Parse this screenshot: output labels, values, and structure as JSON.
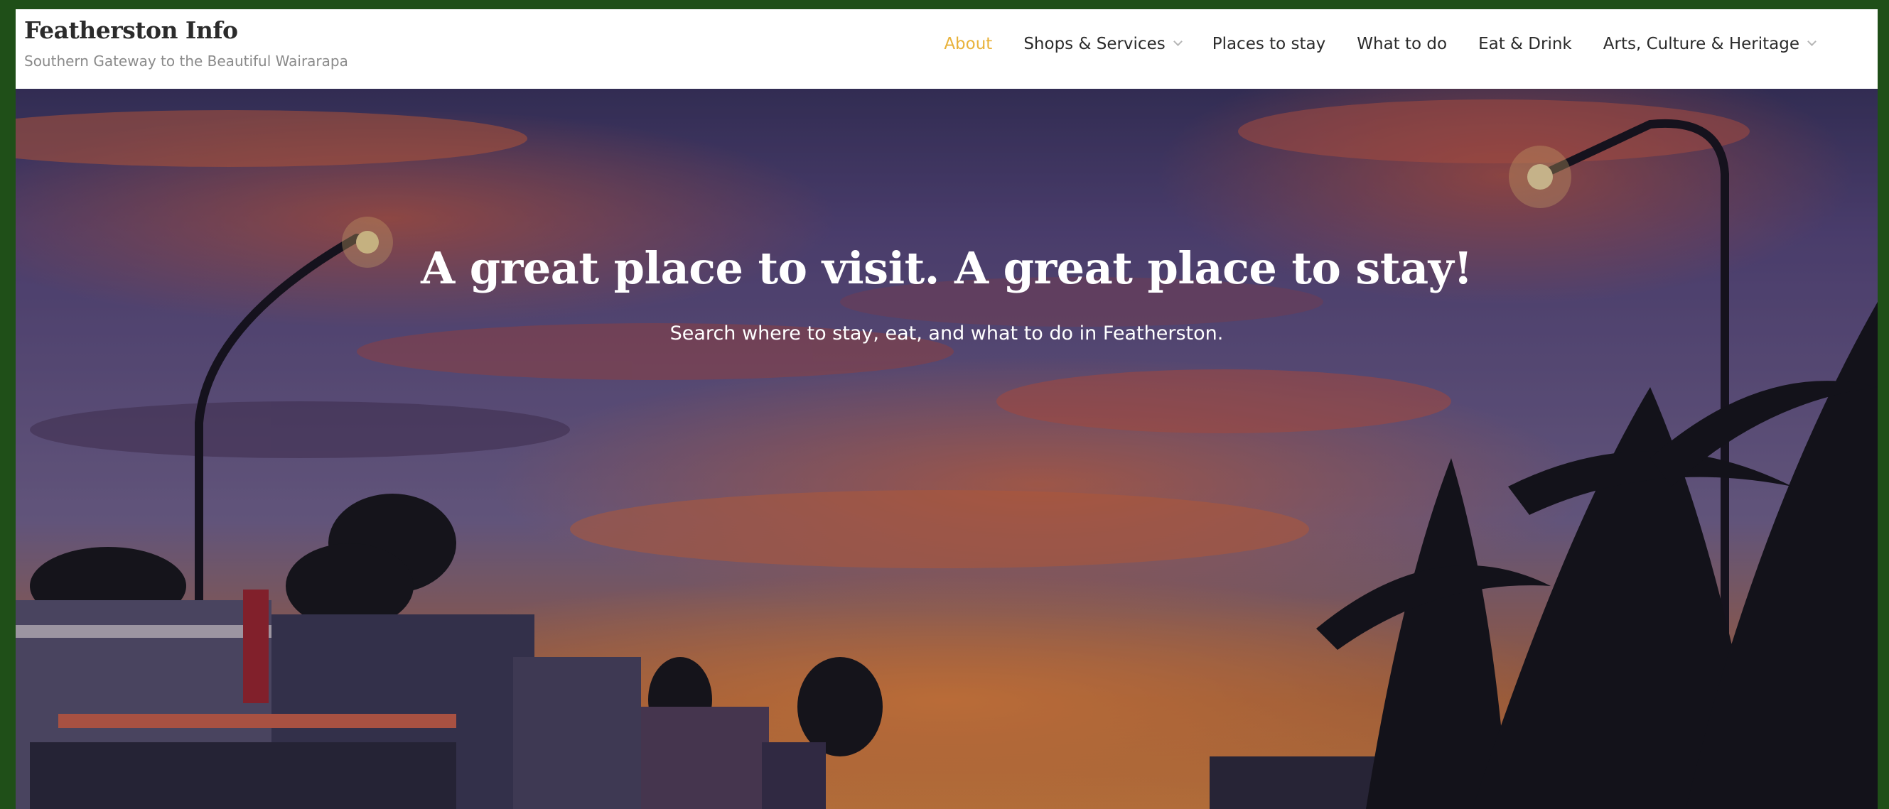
{
  "site": {
    "title": "Featherston Info",
    "tagline": "Southern Gateway to the Beautiful Wairarapa"
  },
  "nav": {
    "items": [
      {
        "label": "About",
        "active": true,
        "has_dropdown": false
      },
      {
        "label": "Shops & Services",
        "active": false,
        "has_dropdown": true
      },
      {
        "label": "Places to stay",
        "active": false,
        "has_dropdown": false
      },
      {
        "label": "What to do",
        "active": false,
        "has_dropdown": false
      },
      {
        "label": "Eat & Drink",
        "active": false,
        "has_dropdown": false
      },
      {
        "label": "Arts, Culture & Heritage",
        "active": false,
        "has_dropdown": true
      }
    ]
  },
  "hero": {
    "title": "A great place to visit. A great place to stay!",
    "subtitle": "Search where to stay, eat, and what to do in Featherston."
  },
  "colors": {
    "page_border": "#1f4f18",
    "active_nav": "#e8b23a",
    "text_dark": "#2b2b2b",
    "tagline": "#8a8a8a"
  }
}
